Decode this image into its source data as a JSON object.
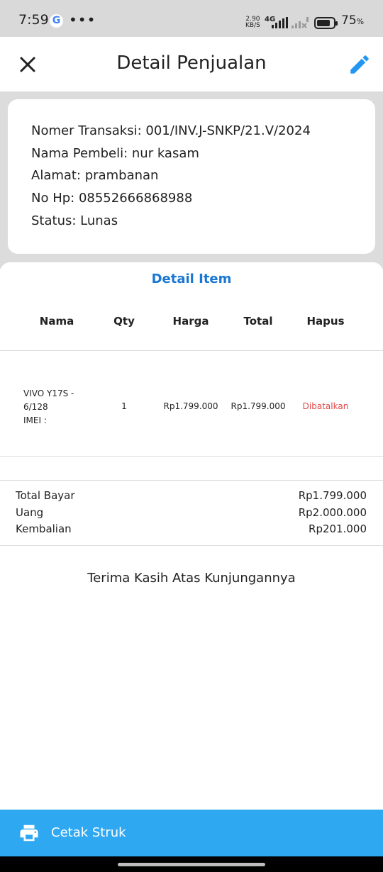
{
  "status_bar": {
    "time": "7:59",
    "google_letter": "G",
    "overflow": "•••",
    "net_speed_value": "2.90",
    "net_speed_unit": "KB/S",
    "network_type": "4G",
    "battery": "75",
    "battery_unit": "%"
  },
  "app_bar": {
    "title": "Detail Penjualan",
    "close_icon": "close-icon",
    "edit_icon": "pencil-icon"
  },
  "info": {
    "transaction": "Nomer Transaksi: 001/INV.J-SNKP/21.V/2024",
    "buyer": "Nama Pembeli: nur kasam",
    "address": "Alamat: prambanan",
    "phone": "No Hp: 08552666868988",
    "status": "Status: Lunas"
  },
  "items_section": {
    "title": "Detail Item",
    "columns": [
      "Nama",
      "Qty",
      "Harga",
      "Total",
      "Hapus"
    ],
    "rows": [
      {
        "name_lines": [
          "VIVO Y17S -",
          "6/128",
          "IMEI :"
        ],
        "qty": "1",
        "price": "Rp1.799.000",
        "total": "Rp1.799.000",
        "action": "Dibatalkan"
      }
    ]
  },
  "summary": {
    "total_label": "Total Bayar",
    "total_value": "Rp1.799.000",
    "cash_label": "Uang",
    "cash_value": "Rp2.000.000",
    "change_label": "Kembalian",
    "change_value": "Rp201.000"
  },
  "footer_message": "Terima Kasih Atas Kunjungannya",
  "print_button": {
    "label": "Cetak Struk",
    "icon": "printer-icon"
  },
  "colors": {
    "accent": "#2fa8f2",
    "link_blue": "#1976d2",
    "cancel_red": "#e04848",
    "background_grey": "#dcdcdc"
  }
}
